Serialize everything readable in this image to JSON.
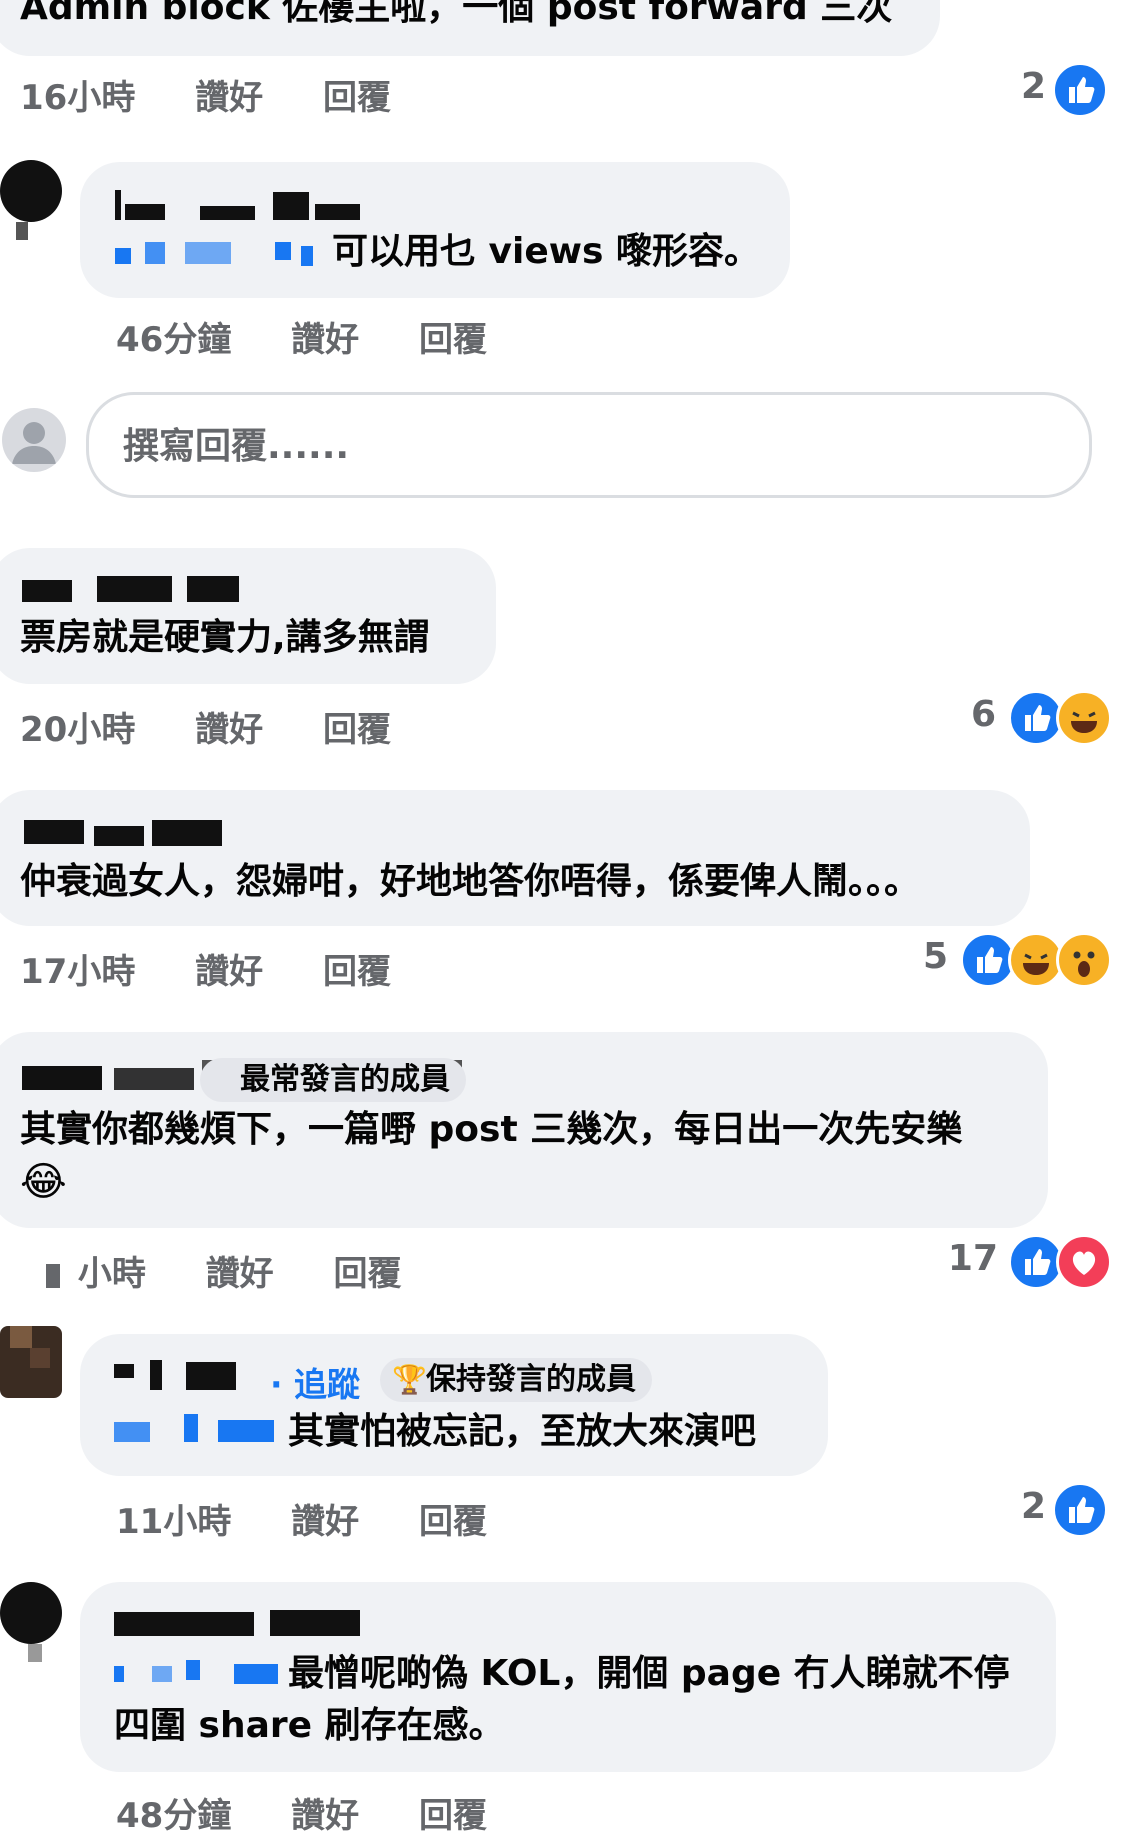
{
  "c0": {
    "text": "Admin block 佐樓主啦，一個 post forward 三次",
    "time": "16小時",
    "like": "讚好",
    "reply": "回覆",
    "reactions": "2"
  },
  "c1": {
    "text": "可以用乜 views 嚟形容。",
    "time": "46分鐘",
    "like": "讚好",
    "reply": "回覆"
  },
  "reply_box": {
    "placeholder": "撰寫回覆......"
  },
  "c2": {
    "text": "票房就是硬實力,講多無謂",
    "time": "20小時",
    "like": "讚好",
    "reply": "回覆",
    "reactions": "6"
  },
  "c3": {
    "text": "仲衰過女人，怨婦咁，好地地答你唔得，係要俾人鬧。。。",
    "time": "17小時",
    "like": "讚好",
    "reply": "回覆",
    "reactions": "5"
  },
  "c4": {
    "badge": "最常發言的成員",
    "text_line1": "其實你都幾煩下，一篇嘢 post 三幾次，每日出一次先安樂",
    "emoji": "😂",
    "time": "小時",
    "like": "讚好",
    "reply": "回覆",
    "reactions": "17"
  },
  "c5": {
    "follow": "· 追蹤",
    "badge": "保持發言的成員",
    "text": "其實怕被忘記，至放大來演吧",
    "time": "11小時",
    "like": "讚好",
    "reply": "回覆",
    "reactions": "2"
  },
  "c6": {
    "text_line1": "最憎呢啲偽 KOL，開個 page 冇人睇就不停",
    "text_line2": "四圍 share 刷存在感。",
    "time": "48分鐘",
    "like": "讚好",
    "reply": "回覆"
  },
  "colors": {
    "bubble": "#f0f2f5",
    "meta": "#65676b",
    "like": "#1877f2",
    "love": "#f33e58",
    "haha": "#f7b125"
  }
}
